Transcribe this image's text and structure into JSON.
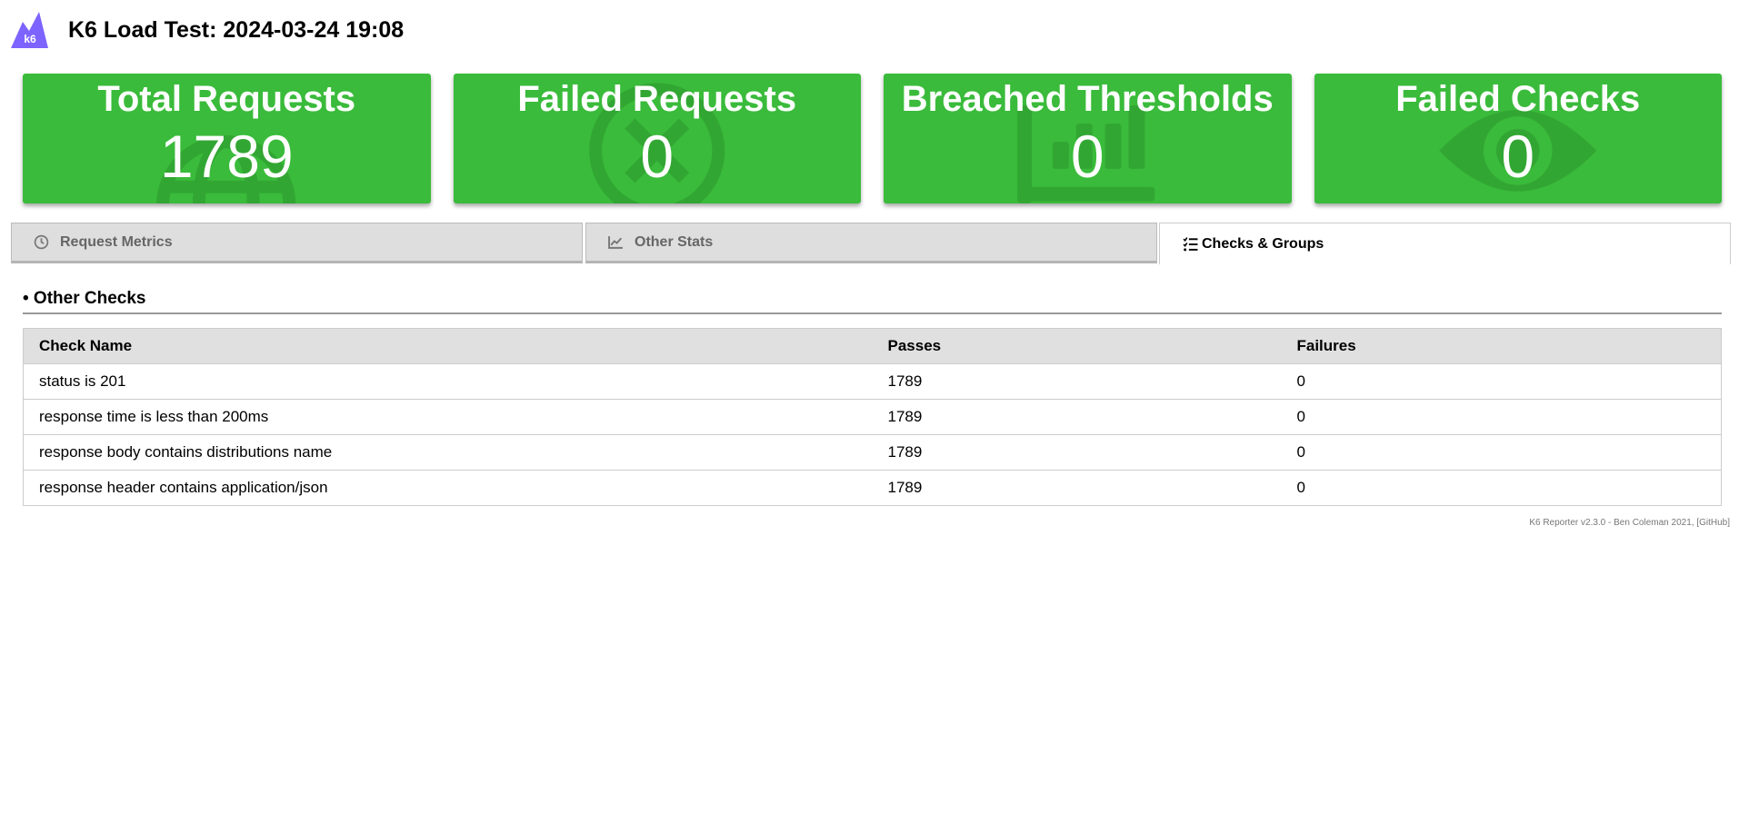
{
  "header": {
    "title": "K6 Load Test: 2024-03-24 19:08",
    "logo_text": "k6",
    "logo_icon": "k6-logo-icon"
  },
  "cards": [
    {
      "title": "Total Requests",
      "value": "1789",
      "icon": "globe-icon"
    },
    {
      "title": "Failed Requests",
      "value": "0",
      "icon": "times-circle-icon"
    },
    {
      "title": "Breached Thresholds",
      "value": "0",
      "icon": "bar-chart-icon"
    },
    {
      "title": "Failed Checks",
      "value": "0",
      "icon": "eye-icon"
    }
  ],
  "tabs": [
    {
      "label": "Request Metrics",
      "icon": "clock-icon",
      "active": false
    },
    {
      "label": "Other Stats",
      "icon": "line-chart-icon",
      "active": false
    },
    {
      "label": "Checks & Groups",
      "icon": "tasks-icon",
      "active": true
    }
  ],
  "section": {
    "title": "• Other Checks"
  },
  "table": {
    "headers": [
      "Check Name",
      "Passes",
      "Failures"
    ],
    "rows": [
      [
        "status is 201",
        "1789",
        "0"
      ],
      [
        "response time is less than 200ms",
        "1789",
        "0"
      ],
      [
        "response body contains distributions name",
        "1789",
        "0"
      ],
      [
        "response header contains application/json",
        "1789",
        "0"
      ]
    ]
  },
  "footer": {
    "text": "K6 Reporter v2.3.0 - Ben Coleman 2021, ",
    "link": "[GitHub]"
  },
  "colors": {
    "card_green": "#3abb3b",
    "logo_purple": "#7d64ff",
    "tab_inactive": "#dedede"
  }
}
